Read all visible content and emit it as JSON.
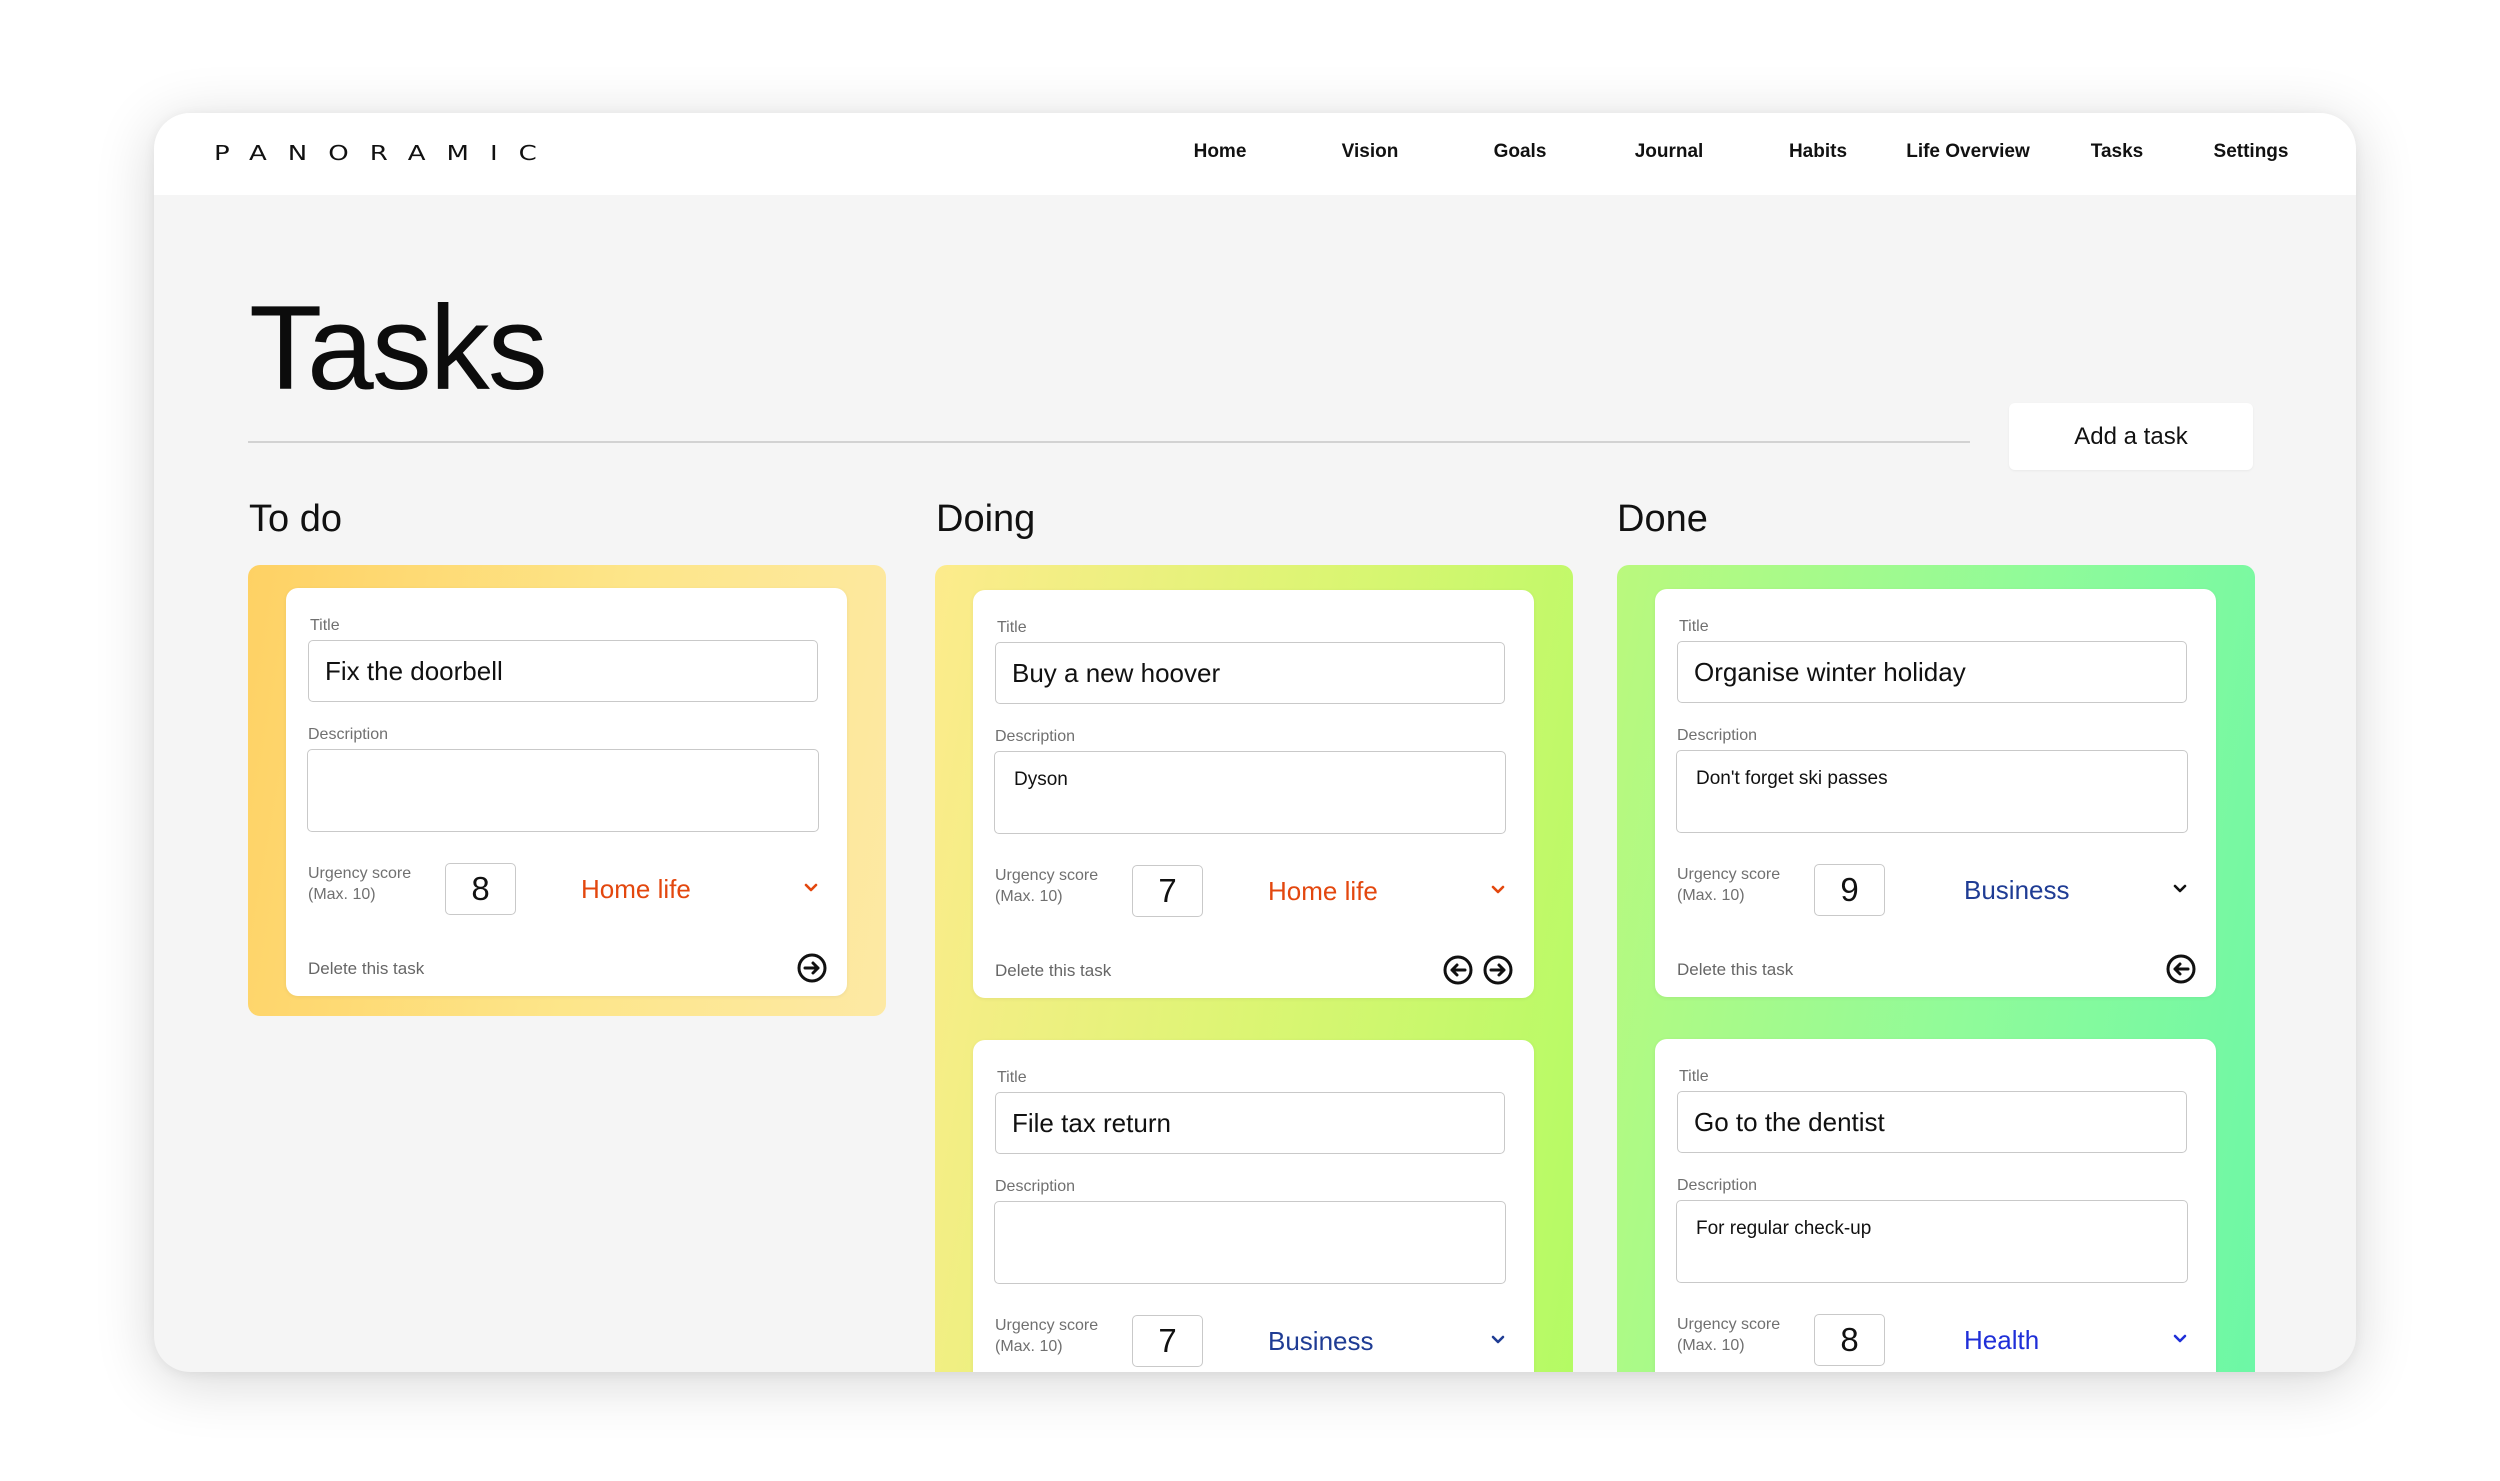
{
  "app": {
    "logo": "PANORAMIC"
  },
  "nav": {
    "items": [
      {
        "label": "Home"
      },
      {
        "label": "Vision"
      },
      {
        "label": "Goals"
      },
      {
        "label": "Journal"
      },
      {
        "label": "Habits"
      },
      {
        "label": "Life Overview"
      },
      {
        "label": "Tasks"
      },
      {
        "label": "Settings"
      }
    ]
  },
  "page": {
    "title": "Tasks",
    "add_button": "Add a task"
  },
  "labels": {
    "title": "Title",
    "description": "Description",
    "urgency": "Urgency score",
    "urgency_max": "(Max. 10)",
    "delete": "Delete this task"
  },
  "colors": {
    "home_life": "#e3470e",
    "business": "#1f3c94",
    "health": "#1f2fd8"
  },
  "icons": {
    "move_left": "circle-arrow-left-icon",
    "move_right": "circle-arrow-right-icon",
    "dropdown": "chevron-down-icon"
  },
  "columns": [
    {
      "name": "To do",
      "tasks": [
        {
          "title": "Fix the doorbell",
          "description": "",
          "urgency": "8",
          "category": "Home life"
        }
      ]
    },
    {
      "name": "Doing",
      "tasks": [
        {
          "title": "Buy a new hoover",
          "description": "Dyson",
          "urgency": "7",
          "category": "Home life"
        },
        {
          "title": "File tax return",
          "description": "",
          "urgency": "7",
          "category": "Business"
        }
      ]
    },
    {
      "name": "Done",
      "tasks": [
        {
          "title": "Organise winter holiday",
          "description": "Don't forget ski passes",
          "urgency": "9",
          "category": "Business"
        },
        {
          "title": "Go to the dentist",
          "description": "For regular check-up",
          "urgency": "8",
          "category": "Health"
        }
      ]
    }
  ]
}
